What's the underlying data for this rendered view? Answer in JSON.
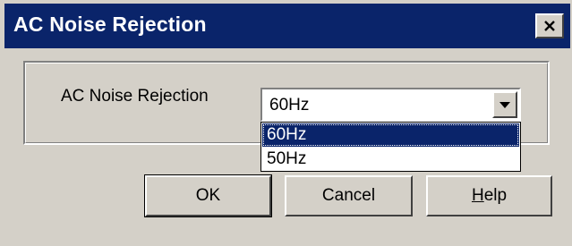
{
  "dialog": {
    "title": "AC Noise Rejection",
    "close_icon": "close-icon"
  },
  "form": {
    "label": "AC Noise Rejection",
    "select": {
      "value": "60Hz",
      "options": [
        "60Hz",
        "50Hz"
      ],
      "highlighted": "60Hz"
    }
  },
  "buttons": {
    "ok": "OK",
    "cancel": "Cancel",
    "help": "Help"
  },
  "colors": {
    "titlebar": "#0a246a",
    "face": "#d4d0c8",
    "highlight": "#0a246a"
  }
}
